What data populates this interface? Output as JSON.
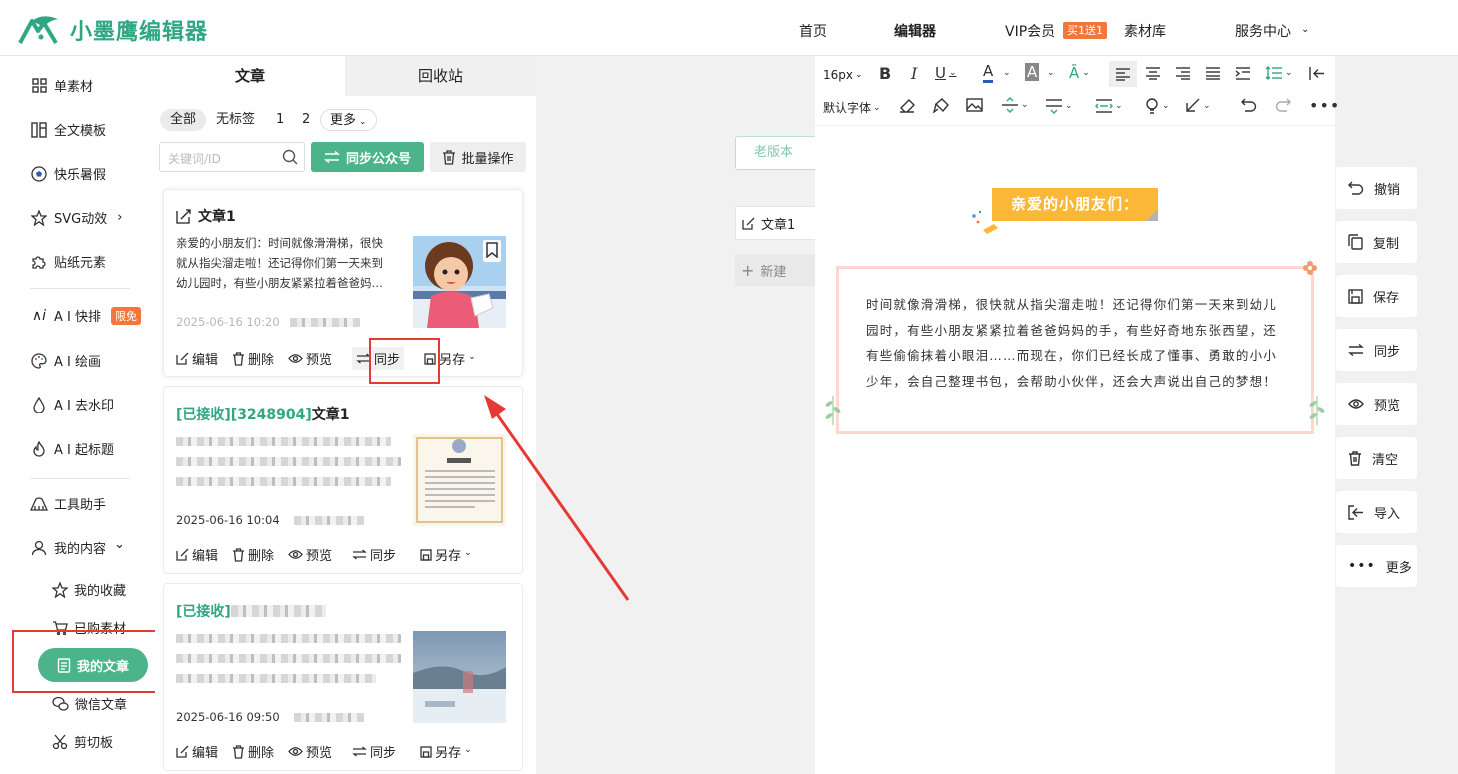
{
  "header": {
    "logo_text": "小墨鹰编辑器",
    "nav": {
      "home": "首页",
      "editor": "编辑器",
      "vip": "VIP会员",
      "vip_badge": "买1送1",
      "materials": "素材库",
      "service": "服务中心"
    }
  },
  "sidebar": {
    "items": [
      {
        "label": "单素材",
        "icon": "grid-icon"
      },
      {
        "label": "全文模板",
        "icon": "template-icon"
      },
      {
        "label": "快乐暑假",
        "icon": "soccer-ball-icon"
      },
      {
        "label": "SVG动效",
        "icon": "star-icon",
        "arrow": "›"
      },
      {
        "label": "贴纸元素",
        "icon": "puzzle-icon"
      },
      {
        "label": "A I 快排",
        "icon": "ai-icon",
        "badge": "限免"
      },
      {
        "label": "A I 绘画",
        "icon": "palette-icon"
      },
      {
        "label": "A I 去水印",
        "icon": "drop-icon"
      },
      {
        "label": "A I 起标题",
        "icon": "flame-icon"
      },
      {
        "label": "工具助手",
        "icon": "ruler-icon"
      },
      {
        "label": "我的内容",
        "icon": "user-icon",
        "arrow": "⌄"
      }
    ],
    "sub_items": [
      {
        "label": "我的收藏",
        "icon": "star-icon"
      },
      {
        "label": "已购素材",
        "icon": "cart-icon"
      },
      {
        "label": "我的文章",
        "icon": "document-icon",
        "active": true
      },
      {
        "label": "微信文章",
        "icon": "wechat-icon"
      },
      {
        "label": "剪切板",
        "icon": "scissors-icon"
      }
    ]
  },
  "articles_panel": {
    "tabs": [
      "文章",
      "回收站"
    ],
    "filters": [
      "全部",
      "无标签",
      "1",
      "2",
      "更多"
    ],
    "search_placeholder": "关键词/ID",
    "sync_button": "同步公众号",
    "batch_button": "批量操作",
    "actions": {
      "edit": "编辑",
      "delete": "删除",
      "preview": "预览",
      "sync": "同步",
      "save_as": "另存"
    },
    "cards": [
      {
        "prefix": "",
        "title": "文章1",
        "lines": [
          "亲爱的小朋友们：时间就像滑滑梯，很快",
          "就从指尖溜走啦！还记得你们第一天来到",
          "幼儿园时，有些小朋友紧紧拉着爸爸妈…"
        ],
        "date": "2025-06-16 10:20"
      },
      {
        "prefix": "[已接收][3248904]",
        "title": "文章1",
        "date": "2025-06-16 10:04"
      },
      {
        "prefix": "[已接收]",
        "title": "",
        "date": "2025-06-16 09:50"
      }
    ]
  },
  "middle": {
    "old_version": "老版本",
    "doc_tab": "文章1",
    "new_doc": "新建"
  },
  "editor": {
    "toolbar": {
      "font_size": "16px",
      "font_family": "默认字体"
    },
    "banner": "亲爱的小朋友们：",
    "body": "时间就像滑滑梯，很快就从指尖溜走啦！还记得你们第一天来到幼儿园时，有些小朋友紧紧拉着爸爸妈妈的手，有些好奇地东张西望，还有些偷偷抹着小眼泪……而现在，你们已经长成了懂事、勇敢的小小少年，会自己整理书包，会帮助小伙伴，还会大声说出自己的梦想！"
  },
  "right_panel": {
    "buttons": [
      {
        "label": "撤销",
        "icon": "undo-icon"
      },
      {
        "label": "复制",
        "icon": "copy-icon"
      },
      {
        "label": "保存",
        "icon": "save-icon"
      },
      {
        "label": "同步",
        "icon": "sync-icon"
      },
      {
        "label": "预览",
        "icon": "eye-icon"
      },
      {
        "label": "清空",
        "icon": "trash-icon"
      },
      {
        "label": "导入",
        "icon": "import-icon"
      },
      {
        "label": "更多",
        "icon": "more-icon"
      }
    ]
  },
  "colors": {
    "brand": "#2fa783",
    "accent_button": "#4bb48a",
    "badge": "#f5763a",
    "highlight_box": "#e53935",
    "banner": "#fbb838"
  }
}
